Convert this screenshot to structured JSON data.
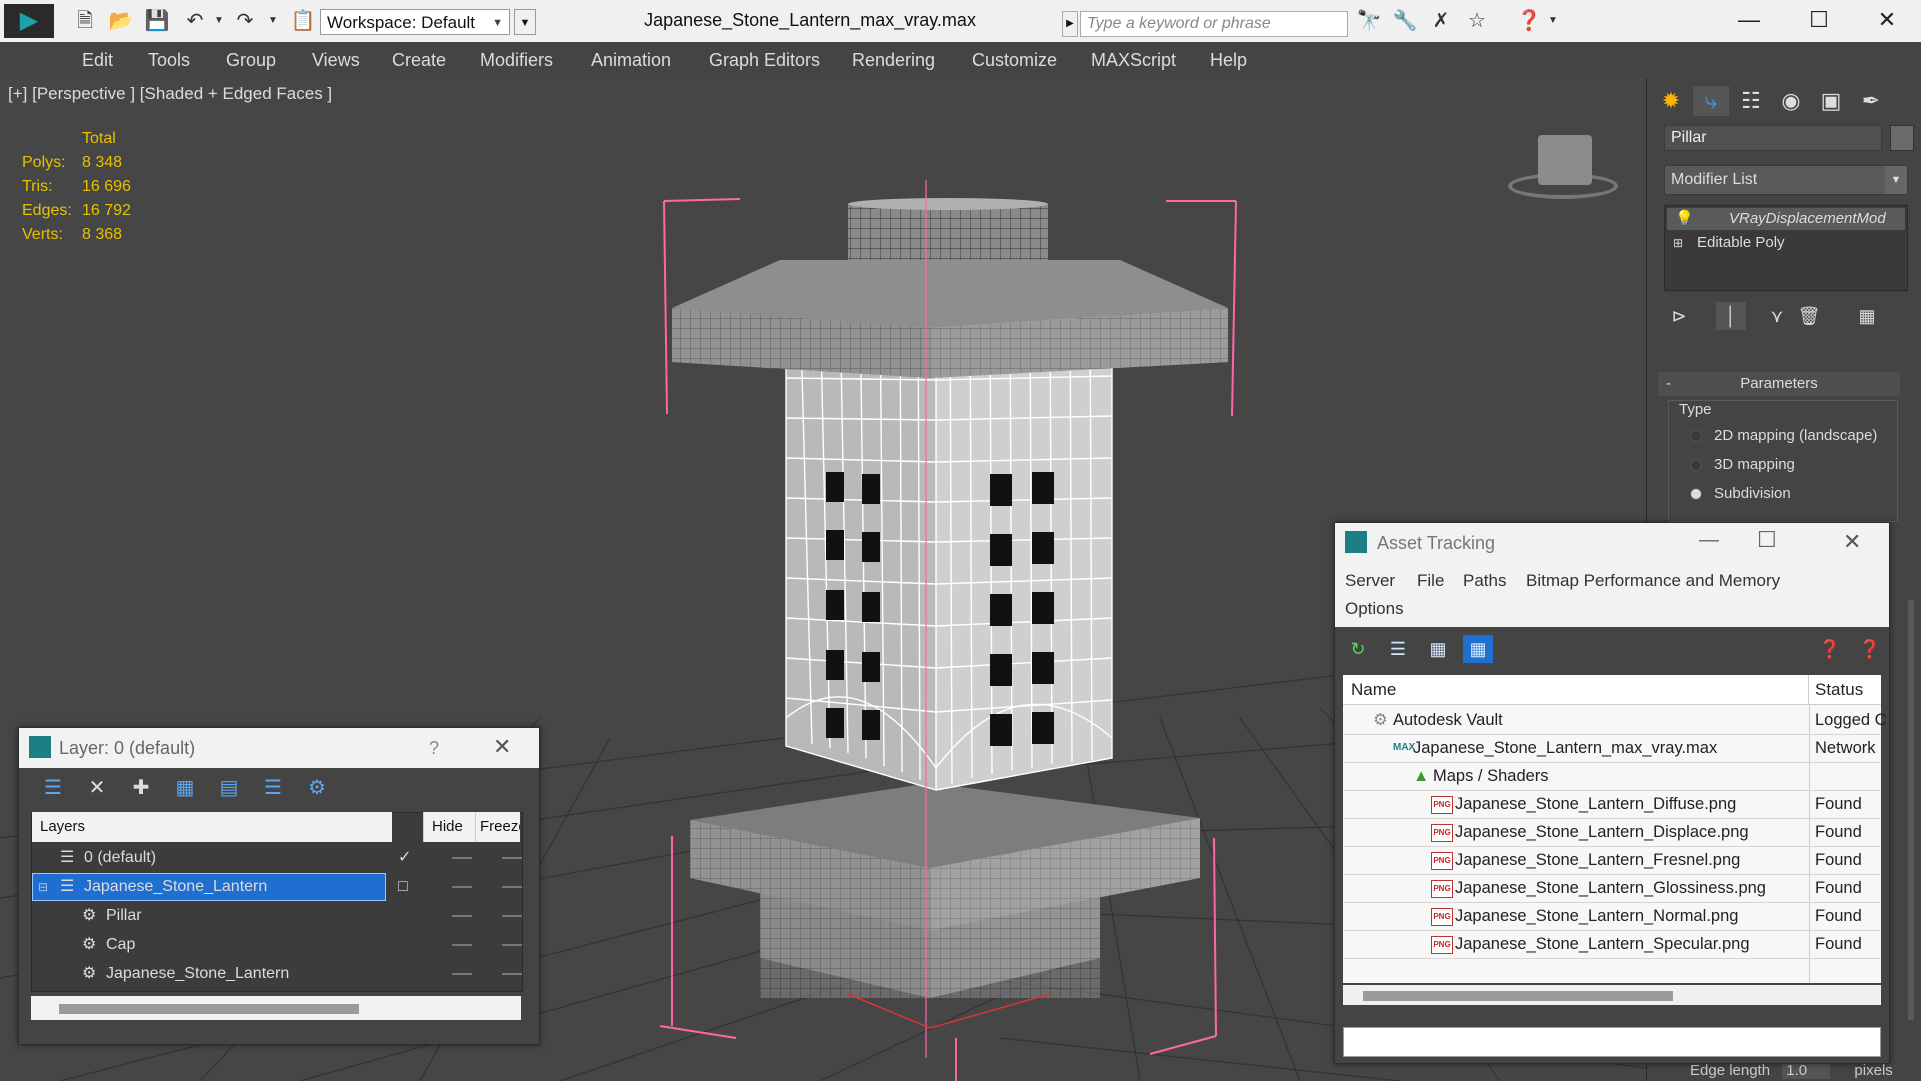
{
  "titlebar": {
    "workspace": "Workspace: Default",
    "document_title": "Japanese_Stone_Lantern_max_vray.max",
    "search_placeholder": "Type a keyword or phrase"
  },
  "menu": [
    "Edit",
    "Tools",
    "Group",
    "Views",
    "Create",
    "Modifiers",
    "Animation",
    "Graph Editors",
    "Rendering",
    "Customize",
    "MAXScript",
    "Help"
  ],
  "viewport": {
    "label": "[+] [Perspective ] [Shaded + Edged Faces ]",
    "stats_header": "Total",
    "stats": [
      {
        "label": "Polys:",
        "value": "8 348"
      },
      {
        "label": "Tris:",
        "value": "16 696"
      },
      {
        "label": "Edges:",
        "value": "16 792"
      },
      {
        "label": "Verts:",
        "value": "8 368"
      }
    ]
  },
  "command_panel": {
    "object_name": "Pillar",
    "modifier_list": "Modifier List",
    "stack": [
      "VRayDisplacementMod",
      "Editable Poly"
    ],
    "parameters_title": "Parameters",
    "parameters_minus": "-",
    "type_label": "Type",
    "type_options": [
      {
        "label": "2D mapping (landscape)",
        "selected": false
      },
      {
        "label": "3D mapping",
        "selected": false
      },
      {
        "label": "Subdivision",
        "selected": true
      }
    ],
    "edge_length_label": "Edge length",
    "edge_length_value": "1.0",
    "edge_length_unit": "pixels"
  },
  "layer_dialog": {
    "title": "Layer: 0 (default)",
    "help": "?",
    "columns": [
      "Layers",
      "Hide",
      "Freeze"
    ],
    "rows": [
      {
        "name": "0 (default)",
        "selected": false,
        "current": true
      },
      {
        "name": "Japanese_Stone_Lantern",
        "selected": true,
        "current": false
      },
      {
        "name": "Pillar",
        "selected": false,
        "current": false
      },
      {
        "name": "Cap",
        "selected": false,
        "current": false
      },
      {
        "name": "Japanese_Stone_Lantern",
        "selected": false,
        "current": false
      }
    ]
  },
  "asset_tracking": {
    "title": "Asset Tracking",
    "menu": [
      "Server",
      "File",
      "Paths",
      "Bitmap Performance and Memory",
      "Options"
    ],
    "columns": [
      "Name",
      "Status"
    ],
    "rows": [
      {
        "name": "Autodesk Vault",
        "status": "Logged C",
        "indent": 1,
        "icon": "vault-icon"
      },
      {
        "name": "Japanese_Stone_Lantern_max_vray.max",
        "status": "Network",
        "indent": 2,
        "icon": "max-file-icon"
      },
      {
        "name": "Maps / Shaders",
        "status": "",
        "indent": 3,
        "icon": "maps-folder-icon"
      },
      {
        "name": "Japanese_Stone_Lantern_Diffuse.png",
        "status": "Found",
        "indent": 4,
        "icon": "png-icon"
      },
      {
        "name": "Japanese_Stone_Lantern_Displace.png",
        "status": "Found",
        "indent": 4,
        "icon": "png-icon"
      },
      {
        "name": "Japanese_Stone_Lantern_Fresnel.png",
        "status": "Found",
        "indent": 4,
        "icon": "png-icon"
      },
      {
        "name": "Japanese_Stone_Lantern_Glossiness.png",
        "status": "Found",
        "indent": 4,
        "icon": "png-icon"
      },
      {
        "name": "Japanese_Stone_Lantern_Normal.png",
        "status": "Found",
        "indent": 4,
        "icon": "png-icon"
      },
      {
        "name": "Japanese_Stone_Lantern_Specular.png",
        "status": "Found",
        "indent": 4,
        "icon": "png-icon"
      }
    ]
  },
  "colors": {
    "selection": "#1e6fd0",
    "stats_yellow": "#e6c200",
    "gizmo_pink": "#ff66aa"
  }
}
